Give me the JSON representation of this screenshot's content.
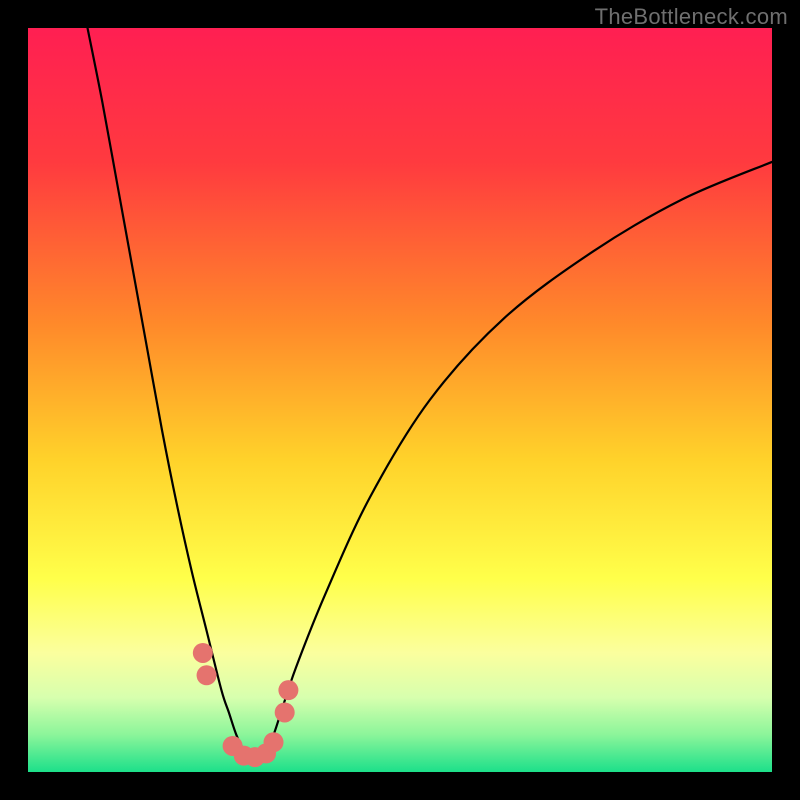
{
  "watermark": "TheBottleneck.com",
  "chart_data": {
    "type": "line",
    "title": "",
    "xlabel": "",
    "ylabel": "",
    "xlim": [
      0,
      100
    ],
    "ylim": [
      0,
      100
    ],
    "gradient_stops": [
      {
        "offset": 0,
        "color": "#ff1f52"
      },
      {
        "offset": 18,
        "color": "#ff3a3f"
      },
      {
        "offset": 40,
        "color": "#ff8a2a"
      },
      {
        "offset": 58,
        "color": "#ffd22a"
      },
      {
        "offset": 74,
        "color": "#ffff4a"
      },
      {
        "offset": 84,
        "color": "#fbff9e"
      },
      {
        "offset": 90,
        "color": "#d7ffae"
      },
      {
        "offset": 95,
        "color": "#8bf59a"
      },
      {
        "offset": 100,
        "color": "#1ce08a"
      }
    ],
    "series": [
      {
        "name": "bottleneck-curve",
        "x": [
          8,
          10,
          12,
          14,
          16,
          18,
          20,
          22,
          24,
          26,
          27,
          28,
          29,
          30,
          31,
          32,
          33,
          34,
          36,
          40,
          46,
          54,
          64,
          76,
          88,
          100
        ],
        "y": [
          100,
          90,
          79,
          68,
          57,
          46,
          36,
          27,
          19,
          11,
          8,
          5,
          3,
          2,
          2,
          3,
          5,
          8,
          14,
          24,
          37,
          50,
          61,
          70,
          77,
          82
        ]
      }
    ],
    "markers": {
      "name": "highlight-dots",
      "color": "#e5736e",
      "radius": 10,
      "points": [
        {
          "x": 23.5,
          "y": 16
        },
        {
          "x": 24.0,
          "y": 13
        },
        {
          "x": 27.5,
          "y": 3.5
        },
        {
          "x": 29.0,
          "y": 2.2
        },
        {
          "x": 30.5,
          "y": 2.0
        },
        {
          "x": 32.0,
          "y": 2.5
        },
        {
          "x": 33.0,
          "y": 4.0
        },
        {
          "x": 34.5,
          "y": 8.0
        },
        {
          "x": 35.0,
          "y": 11.0
        }
      ]
    }
  }
}
